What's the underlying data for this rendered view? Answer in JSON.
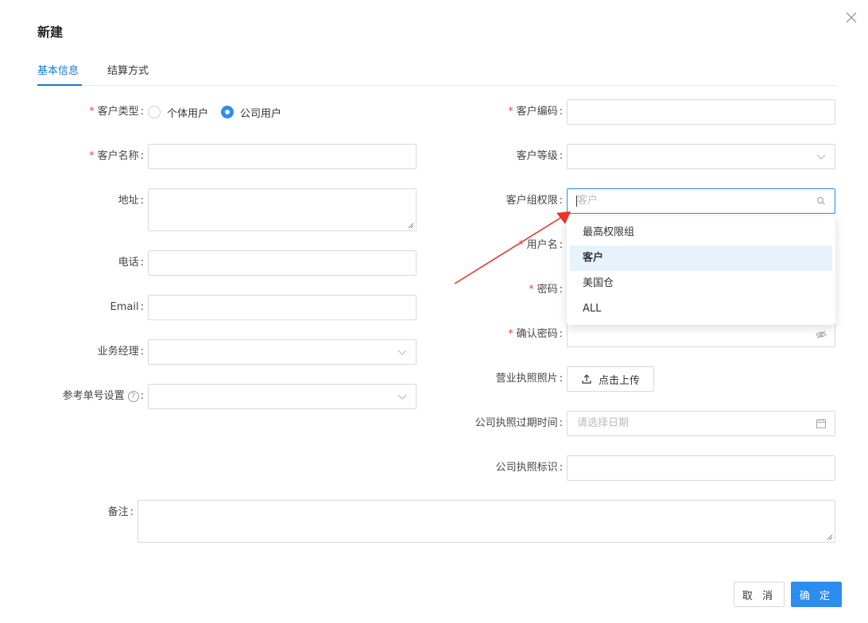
{
  "dialog": {
    "title": "新建"
  },
  "tabs": [
    {
      "label": "基本信息",
      "active": true
    },
    {
      "label": "结算方式",
      "active": false
    }
  ],
  "form": {
    "customer_type": {
      "label": "客户类型",
      "required": true,
      "options": [
        "个体用户",
        "公司用户"
      ],
      "selected": "公司用户"
    },
    "customer_name": {
      "label": "客户名称",
      "required": true,
      "value": ""
    },
    "address": {
      "label": "地址",
      "value": ""
    },
    "phone": {
      "label": "电话",
      "value": ""
    },
    "email": {
      "label": "Email",
      "value": ""
    },
    "sales_manager": {
      "label": "业务经理",
      "value": ""
    },
    "ref_no_setting": {
      "label": "参考单号设置",
      "help": "?",
      "value": ""
    },
    "customer_code": {
      "label": "客户编码",
      "required": true,
      "value": ""
    },
    "customer_level": {
      "label": "客户等级",
      "value": ""
    },
    "group_permission": {
      "label": "客户组权限",
      "placeholder": "客户",
      "options": [
        "最高权限组",
        "客户",
        "美国仓",
        "ALL"
      ],
      "highlighted": "客户"
    },
    "username": {
      "label": "用户名",
      "required": true
    },
    "password": {
      "label": "密码",
      "required": true
    },
    "confirm_password": {
      "label": "确认密码",
      "required": true
    },
    "license_photo": {
      "label": "营业执照照片",
      "button": "点击上传"
    },
    "license_expiry": {
      "label": "公司执照过期时间",
      "placeholder": "请选择日期"
    },
    "license_mark": {
      "label": "公司执照标识",
      "value": ""
    },
    "remark": {
      "label": "备注",
      "value": ""
    }
  },
  "footer": {
    "cancel": "取 消",
    "ok": "确 定"
  },
  "colors": {
    "primary": "#2d8cf0",
    "required": "#f0443c",
    "annotation_arrow": "#e8342b"
  },
  "icons": [
    "close-icon",
    "chevron-down-icon",
    "search-icon",
    "eye-off-icon",
    "upload-icon",
    "calendar-icon",
    "help-icon"
  ]
}
